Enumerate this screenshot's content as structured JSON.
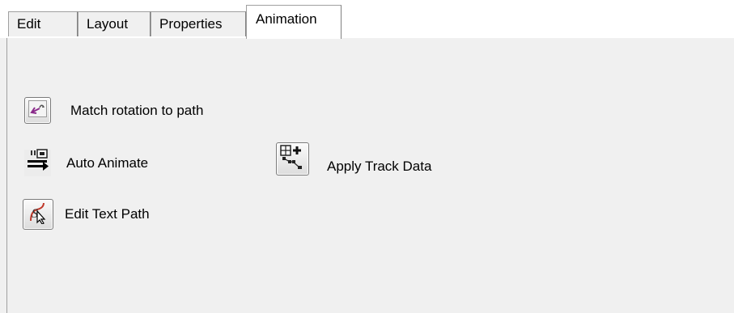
{
  "tabs": [
    {
      "label": "Edit",
      "active": false
    },
    {
      "label": "Layout",
      "active": false
    },
    {
      "label": "Properties",
      "active": false
    },
    {
      "label": "Animation",
      "active": true
    }
  ],
  "tools": {
    "match_rotation": {
      "label": "Match rotation to path",
      "icon": "rotation-path-icon"
    },
    "auto_animate": {
      "label": "Auto Animate",
      "icon": "auto-animate-icon"
    },
    "apply_track": {
      "label": "Apply Track Data",
      "icon": "track-data-icon"
    },
    "edit_text_path": {
      "label": "Edit Text Path",
      "icon": "text-path-icon"
    }
  },
  "colors": {
    "panel_bg": "#f0f0f0",
    "tab_border": "#a0a0a0",
    "accent_purple": "#8a2a8a"
  }
}
